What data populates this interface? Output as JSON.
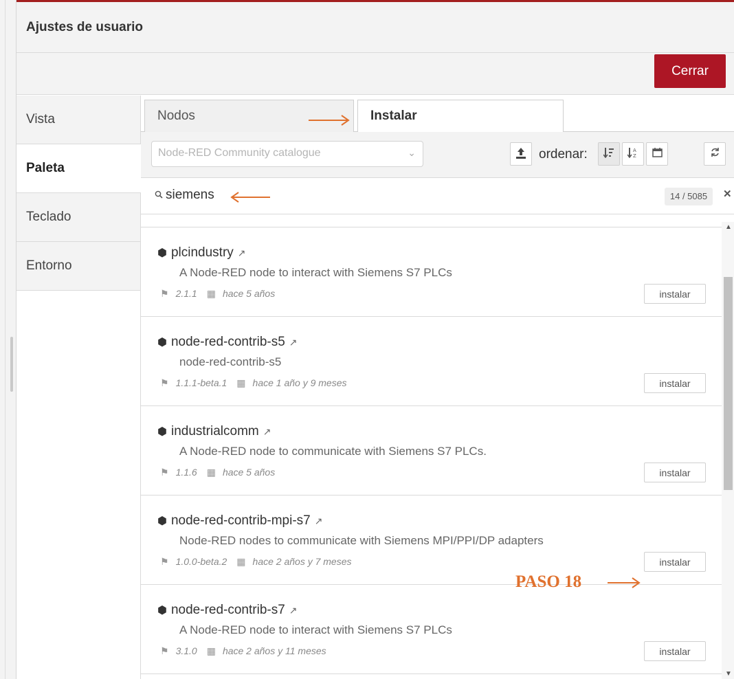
{
  "tray": {
    "title": "Ajustes de usuario",
    "close_label": "Cerrar",
    "accent": "#ad1625"
  },
  "sidebar": {
    "items": [
      {
        "label": "Vista"
      },
      {
        "label": "Paleta"
      },
      {
        "label": "Teclado"
      },
      {
        "label": "Entorno"
      }
    ]
  },
  "tabs": [
    {
      "label": "Nodos"
    },
    {
      "label": "Instalar"
    }
  ],
  "filter": {
    "catalogue": "Node-RED Community catalogue",
    "sort_label": "ordenar:"
  },
  "search": {
    "value": "siemens",
    "count": "14 / 5085"
  },
  "packages": [
    {
      "name": "plcindustry",
      "description": "A Node-RED node to interact with Siemens S7 PLCs",
      "version": "2.1.1",
      "updated": "hace 5 años",
      "action": "instalar"
    },
    {
      "name": "node-red-contrib-s5",
      "description": "node-red-contrib-s5",
      "version": "1.1.1-beta.1",
      "updated": "hace 1 año y 9 meses",
      "action": "instalar"
    },
    {
      "name": "industrialcomm",
      "description": "A Node-RED node to communicate with Siemens S7 PLCs.",
      "version": "1.1.6",
      "updated": "hace 5 años",
      "action": "instalar"
    },
    {
      "name": "node-red-contrib-mpi-s7",
      "description": "Node-RED nodes to communicate with Siemens MPI/PPI/DP adapters",
      "version": "1.0.0-beta.2",
      "updated": "hace 2 años y 7 meses",
      "action": "instalar"
    },
    {
      "name": "node-red-contrib-s7",
      "description": "A Node-RED node to interact with Siemens S7 PLCs",
      "version": "3.1.0",
      "updated": "hace 2 años y 11 meses",
      "action": "instalar"
    }
  ],
  "annotation": {
    "step_label": "PASO 18",
    "color": "#e0712e"
  }
}
